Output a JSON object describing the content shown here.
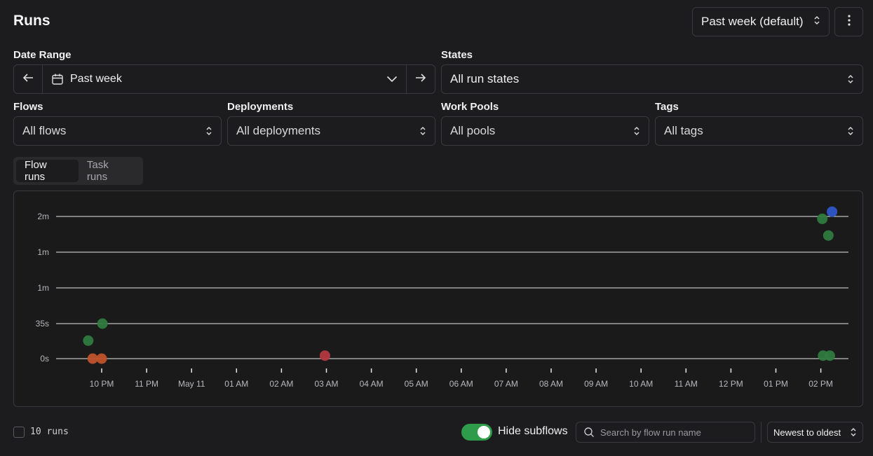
{
  "header": {
    "title": "Runs",
    "range_preset": "Past week (default)"
  },
  "filters": {
    "date_range_label": "Date Range",
    "date_range_value": "Past week",
    "states_label": "States",
    "states_value": "All run states",
    "flows_label": "Flows",
    "flows_value": "All flows",
    "deployments_label": "Deployments",
    "deployments_value": "All deployments",
    "work_pools_label": "Work Pools",
    "work_pools_value": "All pools",
    "tags_label": "Tags",
    "tags_value": "All tags"
  },
  "tabs": [
    {
      "label": "Flow runs",
      "active": true
    },
    {
      "label": "Task runs",
      "active": false
    }
  ],
  "chart_data": {
    "type": "scatter",
    "y_ticks": [
      "2m",
      "1m",
      "1m",
      "35s",
      "0s"
    ],
    "x_ticks": [
      "10 PM",
      "11 PM",
      "May 11",
      "01 AM",
      "02 AM",
      "03 AM",
      "04 AM",
      "05 AM",
      "06 AM",
      "07 AM",
      "08 AM",
      "09 AM",
      "10 AM",
      "11 AM",
      "12 PM",
      "01 PM",
      "02 PM"
    ],
    "colors": {
      "completed": "#2f7a3f",
      "crashed": "#c0522b",
      "failed": "#b3383f",
      "running": "#2f56c8"
    },
    "points": [
      {
        "x": "21:42",
        "y_seconds": 18,
        "state": "completed"
      },
      {
        "x": "22:01",
        "y_seconds": 35,
        "state": "completed"
      },
      {
        "x": "21:48",
        "y_seconds": 0,
        "state": "crashed"
      },
      {
        "x": "22:00",
        "y_seconds": 0,
        "state": "crashed"
      },
      {
        "x": "02:58",
        "y_seconds": 3,
        "state": "failed"
      },
      {
        "x": "14:02",
        "y_seconds": 118,
        "state": "completed"
      },
      {
        "x": "14:10",
        "y_seconds": 104,
        "state": "completed"
      },
      {
        "x": "14:15",
        "y_seconds": 124,
        "state": "running"
      },
      {
        "x": "14:03",
        "y_seconds": 3,
        "state": "completed"
      },
      {
        "x": "14:12",
        "y_seconds": 3,
        "state": "completed"
      }
    ]
  },
  "footer": {
    "runs_count": "10 runs",
    "hide_subflows_label": "Hide subflows",
    "hide_subflows_on": true,
    "search_placeholder": "Search by flow run name",
    "sort_value": "Newest to oldest"
  },
  "icons": {
    "prev": "arrow-left-icon",
    "next": "arrow-right-icon",
    "calendar": "calendar-icon",
    "chevron": "chevron-up-down-icon",
    "menu": "ellipsis-vertical-icon",
    "search": "search-icon"
  }
}
